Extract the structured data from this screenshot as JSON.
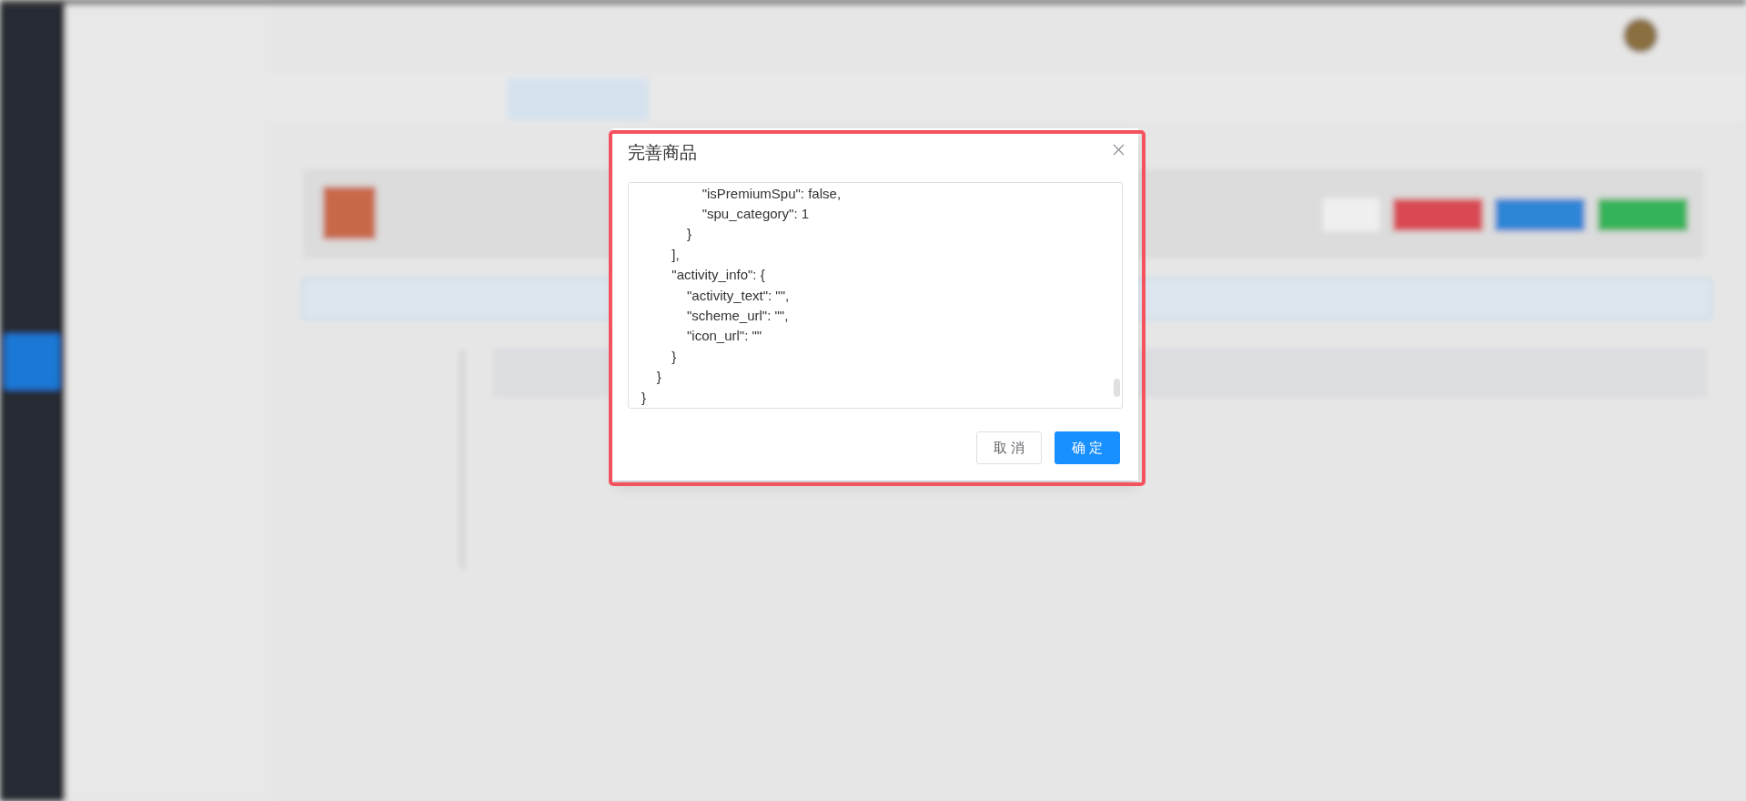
{
  "dialog": {
    "title": "完善商品",
    "code_lines": [
      "                \"isPremiumSpu\": false,",
      "                \"spu_category\": 1",
      "            }",
      "        ],",
      "        \"activity_info\": {",
      "            \"activity_text\": \"\",",
      "            \"scheme_url\": \"\",",
      "            \"icon_url\": \"\"",
      "        }",
      "    }",
      "}"
    ],
    "buttons": [
      {
        "label": "取 消",
        "kind": "default"
      },
      {
        "label": "确 定",
        "kind": "primary"
      }
    ]
  }
}
